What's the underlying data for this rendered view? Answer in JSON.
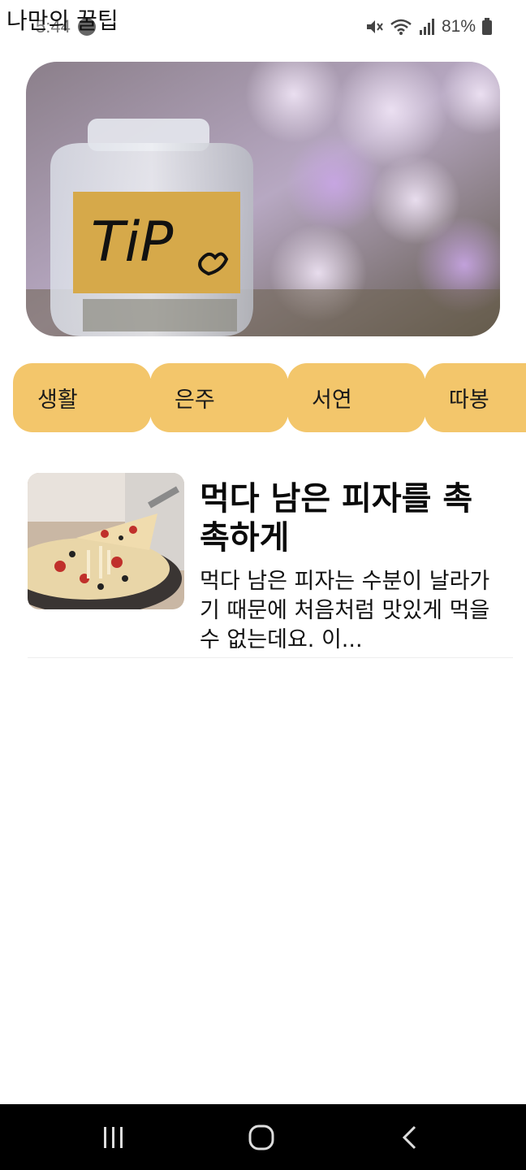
{
  "status_bar": {
    "time": "5:44",
    "battery": "81%",
    "icons": [
      "mute-icon",
      "wifi-icon",
      "signal-icon",
      "battery-icon"
    ]
  },
  "app": {
    "title": "나만의 꿀팁"
  },
  "hero": {
    "image": "tip-jar-image",
    "label_text": "TiP"
  },
  "categories": [
    {
      "label": "생활"
    },
    {
      "label": "은주"
    },
    {
      "label": "서연"
    },
    {
      "label": "따봉"
    }
  ],
  "tips": [
    {
      "title": "먹다 남은 피자를 촉촉하게",
      "body": "먹다 남은 피자는 수분이 날라가기 때문에 처음처럼 맛있게 먹을 수 없는데요. 이...",
      "image": "pizza-image"
    }
  ],
  "nav": {
    "recents": "recents-icon",
    "home": "home-icon",
    "back": "back-icon"
  },
  "colors": {
    "chip": "#f3c66b",
    "nav_bg": "#000000"
  }
}
